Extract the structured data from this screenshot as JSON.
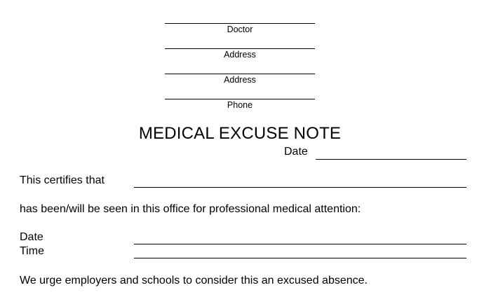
{
  "header": {
    "doctor_label": "Doctor",
    "address_label_1": "Address",
    "address_label_2": "Address",
    "phone_label": "Phone"
  },
  "title": "MEDICAL EXCUSE NOTE",
  "date_field": {
    "label": "Date"
  },
  "certify": {
    "label": "This certifies that"
  },
  "statement": "has been/will be seen in this office for professional medical attention:",
  "visit": {
    "date_label": "Date",
    "time_label": "Time"
  },
  "closing": "We urge employers and schools to consider this an excused absence."
}
